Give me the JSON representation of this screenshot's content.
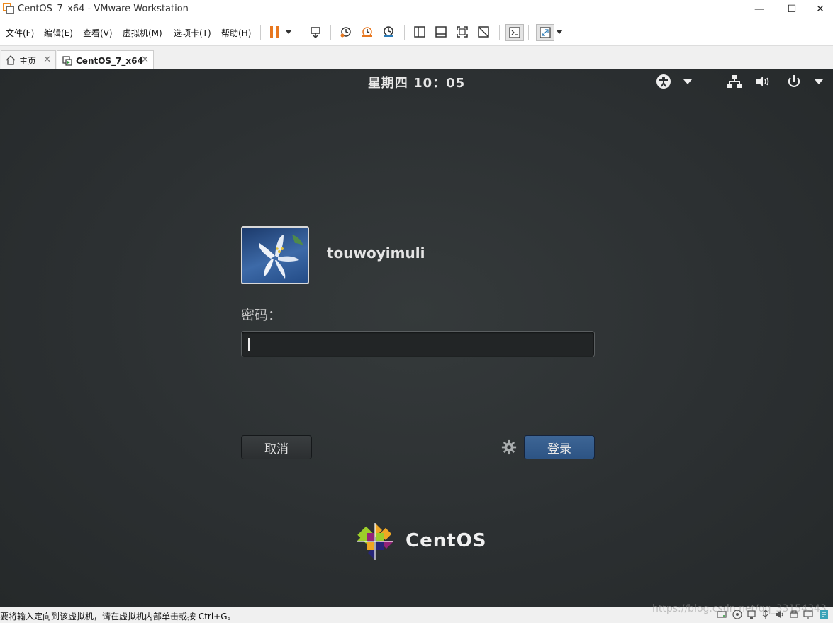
{
  "window": {
    "title": "CentOS_7_x64 - VMware Workstation",
    "minimize": "—",
    "maximize": "☐",
    "close": "✕"
  },
  "menu": {
    "items": [
      "文件(F)",
      "编辑(E)",
      "查看(V)",
      "虚拟机(M)",
      "选项卡(T)",
      "帮助(H)"
    ]
  },
  "tabs": [
    {
      "label": "主页",
      "close": "✕"
    },
    {
      "label": "CentOS_7_x64",
      "close": "✕"
    }
  ],
  "vm": {
    "clock": "星期四 10：05",
    "username": "touwoyimuli",
    "password_label": "密码：",
    "cancel_label": "取消",
    "login_label": "登录",
    "brand": "CentOS"
  },
  "statusbar": {
    "text": "要将输入定向到该虚拟机，请在虚拟机内部单击或按 Ctrl+G。",
    "watermark": "https://blog.csdn.net/qq_33154343"
  },
  "colors": {
    "vm_background": "#2c3032",
    "login_button": "#2f5686",
    "accent_orange": "#e8771f"
  },
  "icons": [
    "vmware-icon",
    "pause-icon",
    "dropdown-icon",
    "send-ctrl-alt-del-icon",
    "snapshot-icon",
    "revert-snapshot-icon",
    "snapshot-manager-icon",
    "console-view-icon",
    "single-window-icon",
    "fit-window-icon",
    "unity-icon",
    "terminal-icon",
    "fullscreen-icon",
    "home-icon",
    "vm-tab-icon",
    "accessibility-icon",
    "network-icon",
    "volume-icon",
    "power-icon",
    "gear-icon",
    "centos-logo"
  ]
}
